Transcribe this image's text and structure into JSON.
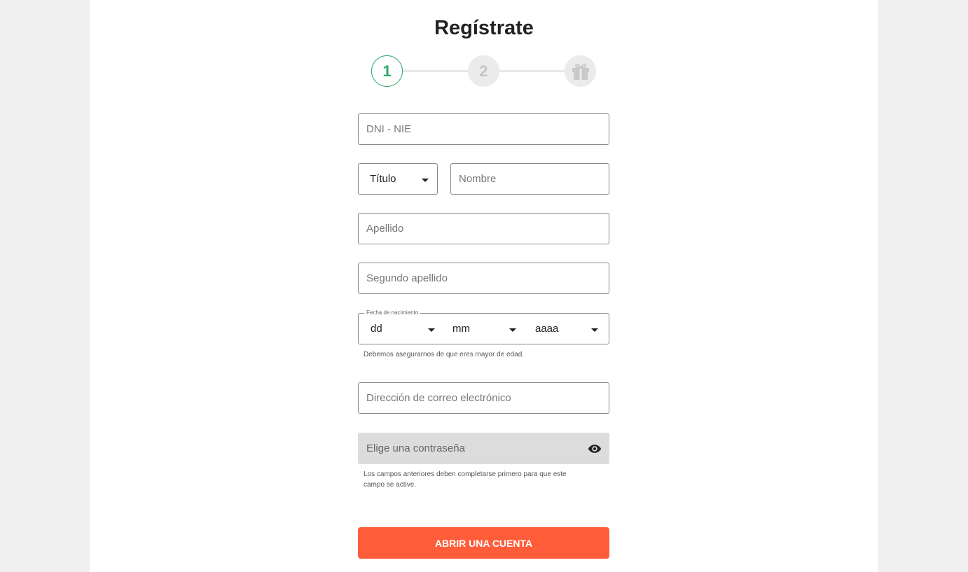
{
  "page": {
    "title": "Regístrate"
  },
  "stepper": {
    "steps": [
      {
        "label": "1",
        "state": "active"
      },
      {
        "label": "2",
        "state": "inactive"
      },
      {
        "label": "",
        "icon": "gift-icon",
        "state": "inactive"
      }
    ],
    "colors": {
      "active": "#2ea86a",
      "inactive_bg": "#ebebeb",
      "inactive_fg": "#c4c4c4"
    }
  },
  "form": {
    "document_id": {
      "placeholder": "DNI - NIE",
      "value": ""
    },
    "title_select": {
      "selected": "Título"
    },
    "first_name": {
      "placeholder": "Nombre",
      "value": ""
    },
    "surname": {
      "placeholder": "Apellido",
      "value": ""
    },
    "second_surname": {
      "placeholder": "Segundo apellido",
      "value": ""
    },
    "birth_date": {
      "legend": "Fecha de nacimiento",
      "day": "dd",
      "month": "mm",
      "year": "aaaa",
      "helper": "Debemos asegurarnos de que eres mayor de edad."
    },
    "email": {
      "placeholder": "Dirección de correo electrónico",
      "value": ""
    },
    "password": {
      "placeholder": "Elige una contraseña",
      "value": "",
      "disabled": true,
      "icon": "eye-icon",
      "helper_line1": "Los campos anteriores deben completarse primero para que este",
      "helper_line2": "campo se active."
    },
    "submit_label": "ABRIR UNA CUENTA"
  },
  "colors": {
    "cta": "#ff5c39",
    "accent": "#2ea86a"
  }
}
